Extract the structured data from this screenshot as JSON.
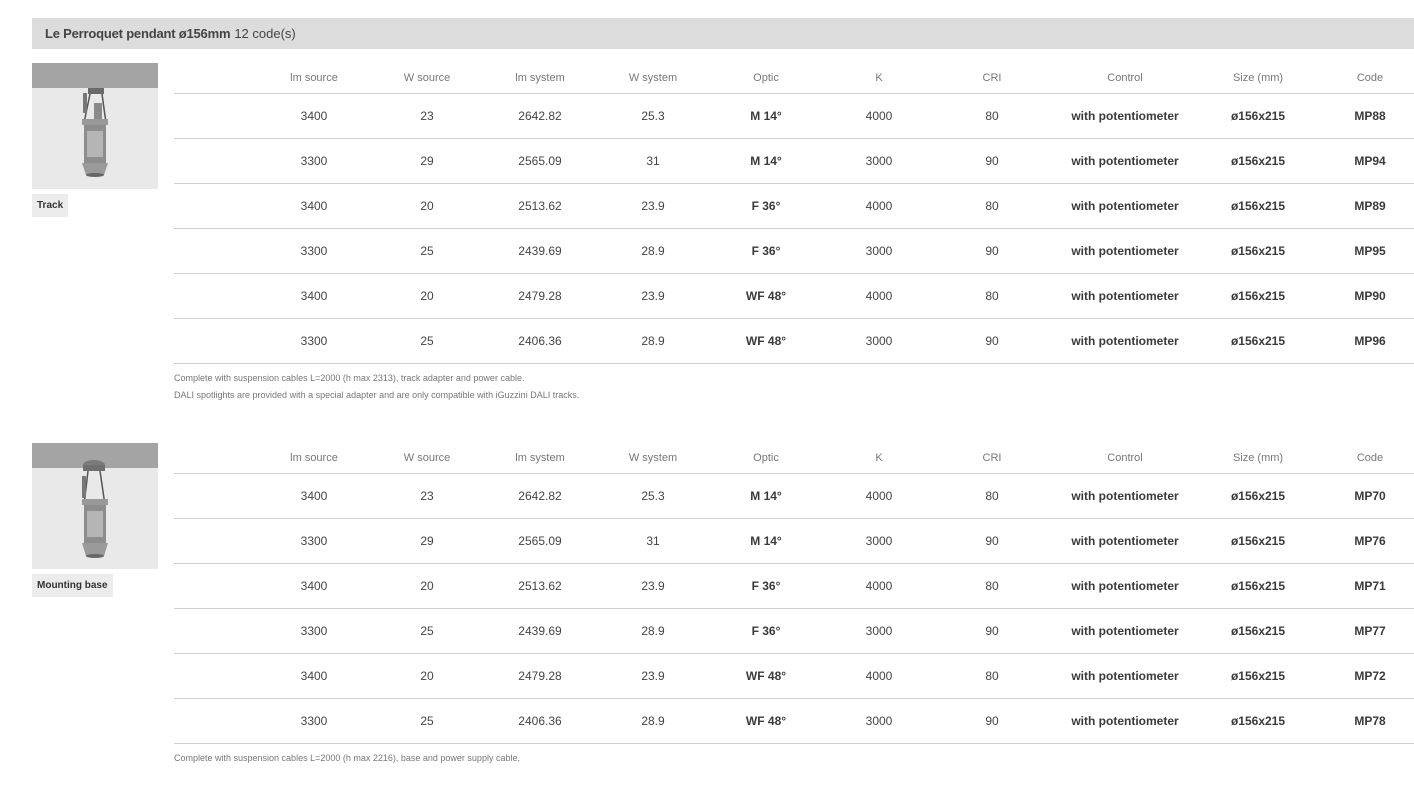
{
  "header": {
    "title": "Le Perroquet pendant ø156mm",
    "code_count": "12 code(s)"
  },
  "columns": [
    "lm source",
    "W source",
    "lm system",
    "W system",
    "Optic",
    "K",
    "CRI",
    "Control",
    "Size (mm)",
    "Code"
  ],
  "sections": [
    {
      "label": "Track",
      "rows": [
        [
          "3400",
          "23",
          "2642.82",
          "25.3",
          "M 14°",
          "4000",
          "80",
          "with potentiometer",
          "ø156x215",
          "MP88"
        ],
        [
          "3300",
          "29",
          "2565.09",
          "31",
          "M 14°",
          "3000",
          "90",
          "with potentiometer",
          "ø156x215",
          "MP94"
        ],
        [
          "3400",
          "20",
          "2513.62",
          "23.9",
          "F 36°",
          "4000",
          "80",
          "with potentiometer",
          "ø156x215",
          "MP89"
        ],
        [
          "3300",
          "25",
          "2439.69",
          "28.9",
          "F 36°",
          "3000",
          "90",
          "with potentiometer",
          "ø156x215",
          "MP95"
        ],
        [
          "3400",
          "20",
          "2479.28",
          "23.9",
          "WF 48°",
          "4000",
          "80",
          "with potentiometer",
          "ø156x215",
          "MP90"
        ],
        [
          "3300",
          "25",
          "2406.36",
          "28.9",
          "WF 48°",
          "3000",
          "90",
          "with potentiometer",
          "ø156x215",
          "MP96"
        ]
      ],
      "notes": [
        "Complete with suspension cables L=2000 (h max 2313), track adapter and power cable.",
        "DALI spotlights are provided with a special adapter and are only compatible with iGuzzini DALI tracks."
      ]
    },
    {
      "label": "Mounting base",
      "rows": [
        [
          "3400",
          "23",
          "2642.82",
          "25.3",
          "M 14°",
          "4000",
          "80",
          "with potentiometer",
          "ø156x215",
          "MP70"
        ],
        [
          "3300",
          "29",
          "2565.09",
          "31",
          "M 14°",
          "3000",
          "90",
          "with potentiometer",
          "ø156x215",
          "MP76"
        ],
        [
          "3400",
          "20",
          "2513.62",
          "23.9",
          "F 36°",
          "4000",
          "80",
          "with potentiometer",
          "ø156x215",
          "MP71"
        ],
        [
          "3300",
          "25",
          "2439.69",
          "28.9",
          "F 36°",
          "3000",
          "90",
          "with potentiometer",
          "ø156x215",
          "MP77"
        ],
        [
          "3400",
          "20",
          "2479.28",
          "23.9",
          "WF 48°",
          "4000",
          "80",
          "with potentiometer",
          "ø156x215",
          "MP72"
        ],
        [
          "3300",
          "25",
          "2406.36",
          "28.9",
          "WF 48°",
          "3000",
          "90",
          "with potentiometer",
          "ø156x215",
          "MP78"
        ]
      ],
      "notes": [
        "Complete with suspension cables L=2000 (h max 2216), base and power supply cable."
      ]
    }
  ]
}
